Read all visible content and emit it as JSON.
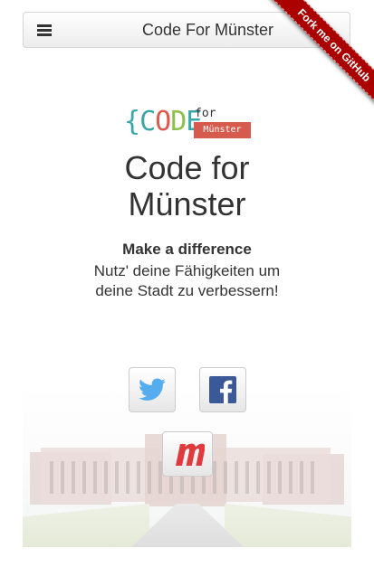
{
  "navbar": {
    "brand": "Code For Münster",
    "menu_icon": "hamburger-icon"
  },
  "ribbon": {
    "label": "Fork me on GitHub",
    "color": "#aa0000"
  },
  "logo": {
    "letters": [
      "{",
      "C",
      "O",
      "D",
      "E",
      "}"
    ],
    "letter_colors": [
      "#3aa6a5",
      "#3aa6a5",
      "#e0574b",
      "#8cc04b",
      "#3aa6a5",
      "#e0574b"
    ],
    "for_text": "for",
    "city_text": "Münster",
    "city_color": "#d65b4e"
  },
  "hero": {
    "title_line1": "Code for",
    "title_line2": "Münster",
    "tagline": "Make a difference",
    "description": "Nutz' deine Fähigkeiten um deine Stadt zu verbessern!"
  },
  "social": [
    {
      "name": "Twitter",
      "icon": "twitter-icon",
      "color": "#55acee"
    },
    {
      "name": "Facebook",
      "icon": "facebook-icon",
      "color": "#3b5998"
    },
    {
      "name": "Meetup",
      "icon": "meetup-icon",
      "color": "#e0393e"
    }
  ],
  "background": {
    "image": "schloss-photo"
  }
}
